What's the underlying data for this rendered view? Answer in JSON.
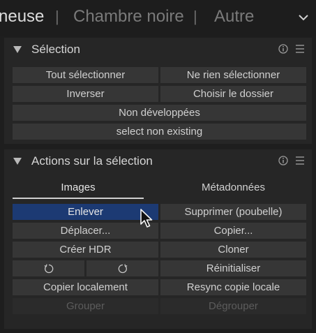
{
  "topbar": {
    "tabs": [
      {
        "label": "neuse",
        "active": true
      },
      {
        "label": "Chambre noire",
        "active": false
      },
      {
        "label": "Autre",
        "active": false
      }
    ],
    "separator": "|",
    "more_icon": "chevron-down-icon"
  },
  "selection_module": {
    "title": "Sélection",
    "icons": [
      "info-icon",
      "hamburger-menu-icon"
    ],
    "buttons": {
      "select_all": "Tout sélectionner",
      "select_none": "Ne rien sélectionner",
      "invert": "Inverser",
      "select_film_roll": "Choisir le dossier",
      "select_untouched": "Non développées",
      "select_non_existing": "select non existing"
    }
  },
  "actions_module": {
    "title": "Actions sur la sélection",
    "icons": [
      "info-icon",
      "hamburger-menu-icon"
    ],
    "tabs": {
      "images": "Images",
      "metadata": "Métadonnées",
      "active": "images"
    },
    "buttons": {
      "remove": "Enlever",
      "delete_trash": "Supprimer (poubelle)",
      "move": "Déplacer...",
      "copy": "Copier...",
      "create_hdr": "Créer HDR",
      "duplicate": "Cloner",
      "rotate_ccw_icon": "rotate-counterclockwise-icon",
      "rotate_cw_icon": "rotate-clockwise-icon",
      "reset": "Réinitialiser",
      "copy_locally": "Copier localement",
      "resync_local_copy": "Resync copie locale",
      "group": "Grouper",
      "ungroup": "Dégrouper"
    },
    "highlighted_button": "remove",
    "disabled_buttons": [
      "group",
      "ungroup"
    ]
  },
  "colors": {
    "background": "#1e1e1e",
    "panel": "#262626",
    "button": "#363636",
    "button_active": "#1c3a73",
    "text": "#d0d0d0",
    "text_disabled": "#5c5c5c"
  }
}
